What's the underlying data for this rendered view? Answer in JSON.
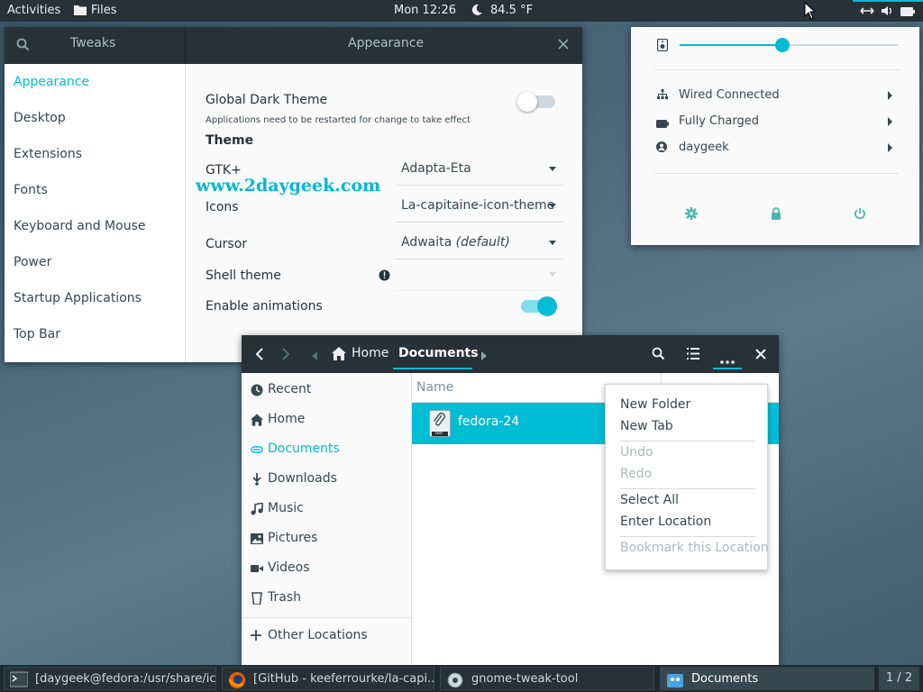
{
  "topbar": {
    "activities": "Activities",
    "app_menu": "Files",
    "clock": "Mon 12:26",
    "weather": "84.5 °F"
  },
  "tweaks": {
    "search_icon": "search-icon",
    "sidebar_title": "Tweaks",
    "title": "Appearance",
    "sidebar": [
      "Appearance",
      "Desktop",
      "Extensions",
      "Fonts",
      "Keyboard and Mouse",
      "Power",
      "Startup Applications",
      "Top Bar"
    ],
    "global_dark_label": "Global Dark Theme",
    "global_dark_note": "Applications need to be restarted for change to take effect",
    "theme_heading": "Theme",
    "gtk_label": "GTK+",
    "gtk_value": "Adapta-Eta",
    "icons_label": "Icons",
    "icons_value": "La-capitaine-icon-theme",
    "cursor_label": "Cursor",
    "cursor_value": "Adwaita",
    "cursor_suffix": "(default)",
    "shell_label": "Shell theme",
    "shell_value": "",
    "animations_label": "Enable animations",
    "global_dark_on": false,
    "animations_on": true
  },
  "watermark": "www.2daygeek.com",
  "tray": {
    "volume_level": 0.47,
    "items": [
      {
        "label": "Wired Connected",
        "icon": "network-icon"
      },
      {
        "label": "Fully Charged",
        "icon": "battery-icon"
      },
      {
        "label": "daygeek",
        "icon": "user-icon"
      }
    ]
  },
  "files": {
    "path": [
      "Home",
      "Documents"
    ],
    "places": [
      {
        "label": "Recent",
        "icon": "recent-icon"
      },
      {
        "label": "Home",
        "icon": "home-icon"
      },
      {
        "label": "Documents",
        "icon": "documents-icon"
      },
      {
        "label": "Downloads",
        "icon": "downloads-icon"
      },
      {
        "label": "Music",
        "icon": "music-icon"
      },
      {
        "label": "Pictures",
        "icon": "pictures-icon"
      },
      {
        "label": "Videos",
        "icon": "videos-icon"
      },
      {
        "label": "Trash",
        "icon": "trash-icon"
      }
    ],
    "other_locations": "Other Locations",
    "column_name": "Name",
    "file_name": "fedora-24",
    "file_icon_label": "text",
    "menu": {
      "new_folder": "New Folder",
      "new_tab": "New Tab",
      "undo": "Undo",
      "redo": "Redo",
      "select_all": "Select All",
      "enter_location": "Enter Location",
      "bookmark": "Bookmark this Location"
    }
  },
  "taskbar": {
    "tasks": [
      "[daygeek@fedora:/usr/share/ic...",
      "[GitHub - keeferrourke/la-capi...",
      "gnome-tweak-tool",
      "Documents"
    ],
    "workspace": "1 / 2"
  },
  "colors": {
    "accent": "#00bcd4",
    "header": "#263238",
    "watermark": "#00b7d6"
  }
}
